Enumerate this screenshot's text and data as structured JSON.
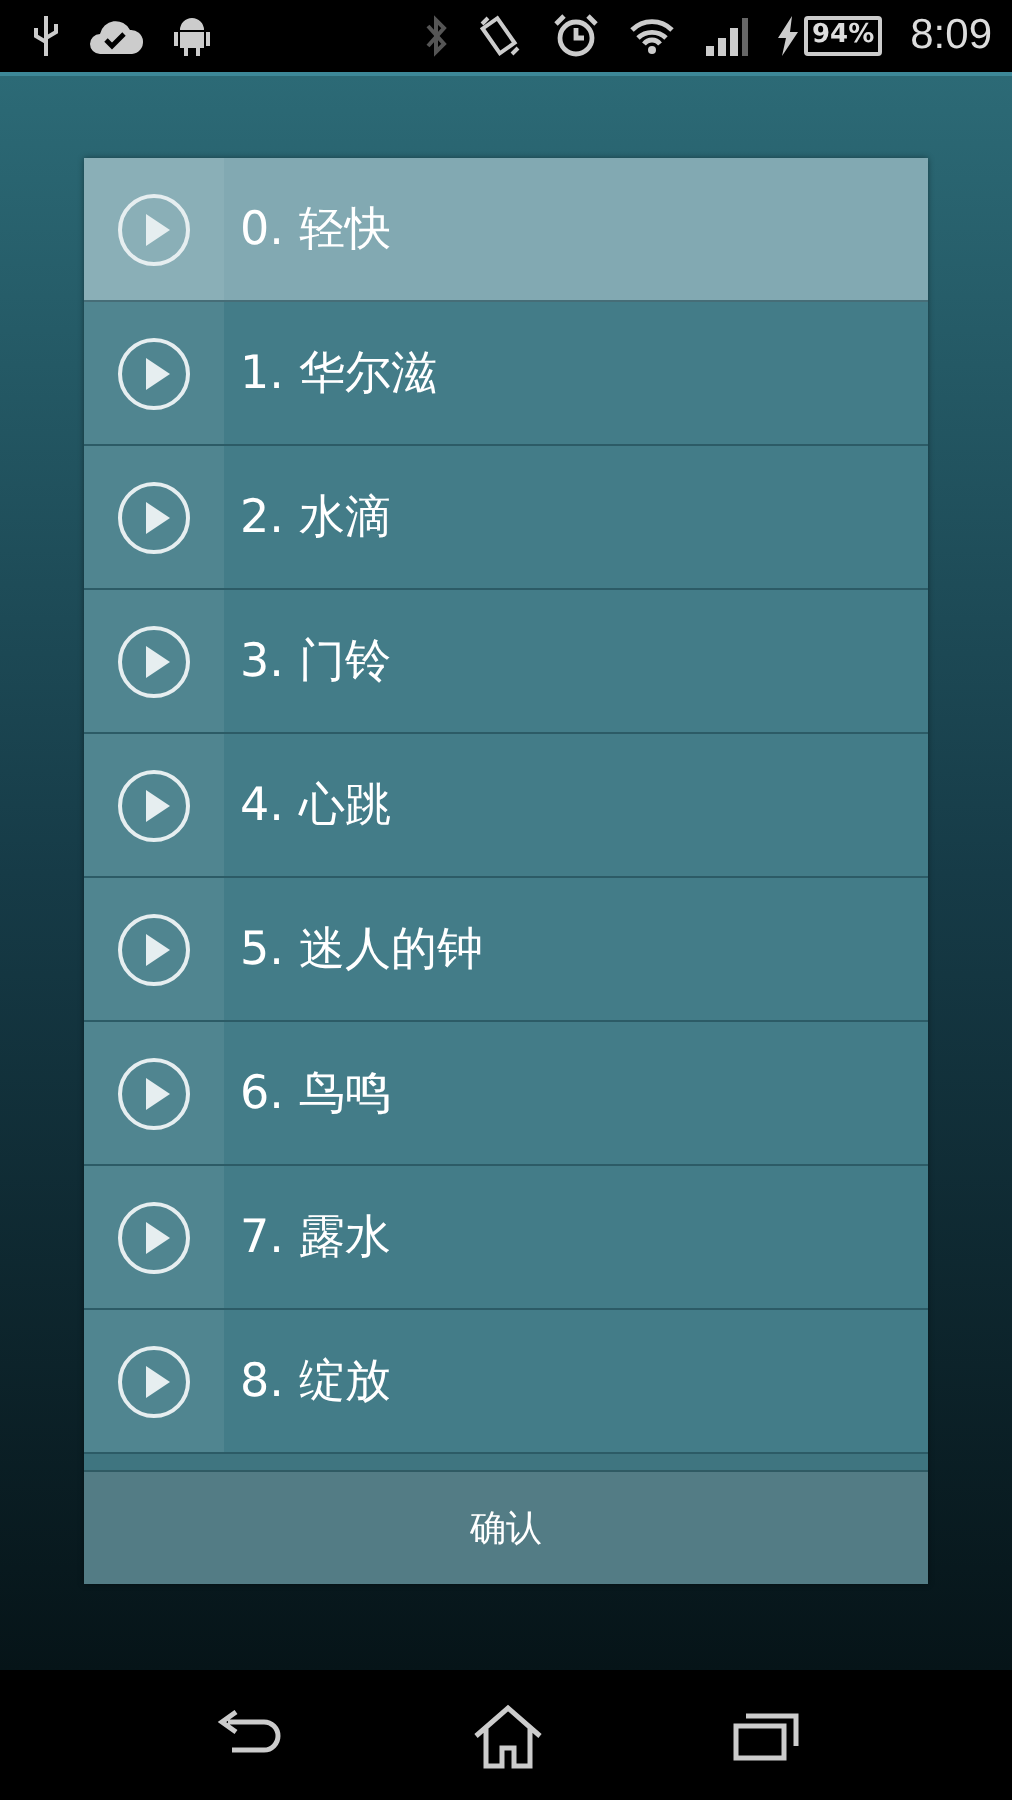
{
  "status_bar": {
    "battery": "94%",
    "time": "8:09"
  },
  "dialog": {
    "items": [
      {
        "label": "0. 轻快",
        "selected": true
      },
      {
        "label": "1. 华尔滋",
        "selected": false
      },
      {
        "label": "2. 水滴",
        "selected": false
      },
      {
        "label": "3. 门铃",
        "selected": false
      },
      {
        "label": "4. 心跳",
        "selected": false
      },
      {
        "label": "5. 迷人的钟",
        "selected": false
      },
      {
        "label": "6. 鸟鸣",
        "selected": false
      },
      {
        "label": "7. 露水",
        "selected": false
      },
      {
        "label": "8. 绽放",
        "selected": false
      }
    ],
    "confirm_button": "确认"
  }
}
